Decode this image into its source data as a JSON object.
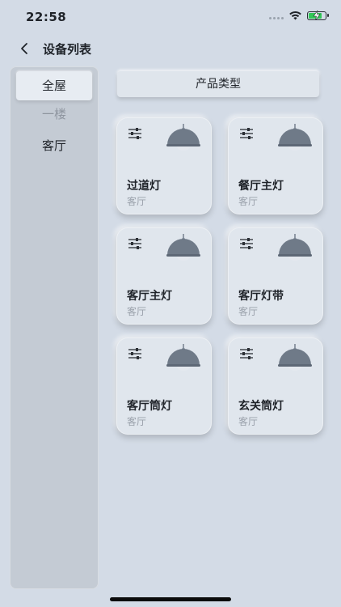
{
  "status": {
    "time": "22:58"
  },
  "header": {
    "title": "设备列表"
  },
  "sidebar": {
    "items": [
      {
        "label": "全屋"
      },
      {
        "label": "一楼"
      },
      {
        "label": "客厅"
      }
    ]
  },
  "filter": {
    "label": "产品类型"
  },
  "devices": [
    {
      "name": "过道灯",
      "room": "客厅"
    },
    {
      "name": "餐厅主灯",
      "room": "客厅"
    },
    {
      "name": "客厅主灯",
      "room": "客厅"
    },
    {
      "name": "客厅灯带",
      "room": "客厅"
    },
    {
      "name": "客厅筒灯",
      "room": "客厅"
    },
    {
      "name": "玄关筒灯",
      "room": "客厅"
    }
  ],
  "icons": {
    "card_settings": "sliders-icon",
    "card_device": "pendant-lamp-icon",
    "back": "chevron-left-icon"
  },
  "colors": {
    "background": "#d3dbe6",
    "sidebar": "#c4cbd4",
    "card": "#e0e6ed",
    "battery_charging": "#34c759",
    "lamp": "#6f7a88"
  }
}
